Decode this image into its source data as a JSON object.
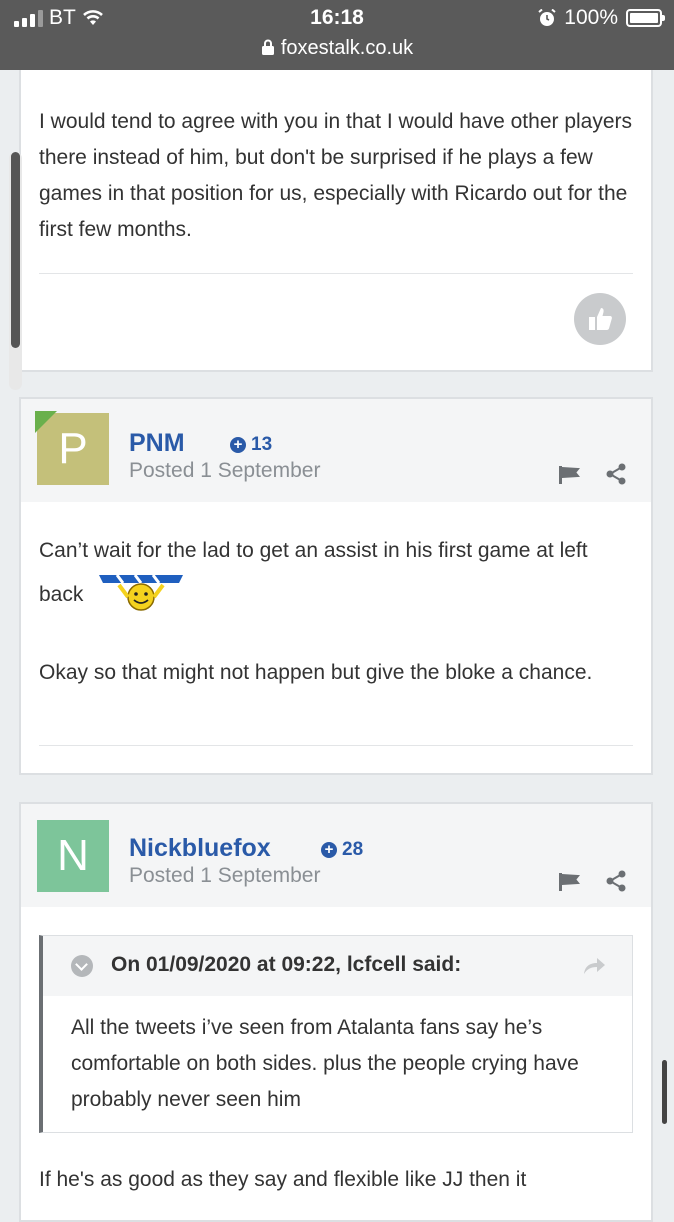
{
  "status_bar": {
    "carrier": "BT",
    "time": "16:18",
    "battery": "100%",
    "url": "foxestalk.co.uk"
  },
  "previous_post": {
    "text": "I would tend to agree with you in that I would have other players there instead of him, but don't be surprised if he plays a few games in that position for us, especially with Ricardo out for the first few months."
  },
  "posts": [
    {
      "avatar_letter": "P",
      "avatar_color": "#c4c07a",
      "username": "PNM",
      "reputation": "13",
      "posted": "Posted 1 September",
      "paragraph1": "Can’t wait for the lad to get an assist in his first game at left back",
      "paragraph2": "Okay so that might not happen but give the bloke a chance."
    },
    {
      "avatar_letter": "N",
      "avatar_color": "#7dc59a",
      "username": "Nickbluefox",
      "reputation": "28",
      "posted": "Posted 1 September",
      "quote_title": "On 01/09/2020 at 09:22, lcfcell said:",
      "quote_text": "All the tweets i’ve seen from Atalanta fans say he’s comfortable on both sides. plus the people crying have probably never seen him",
      "reply_text": "If he's as good as they say and flexible like JJ then it"
    }
  ]
}
